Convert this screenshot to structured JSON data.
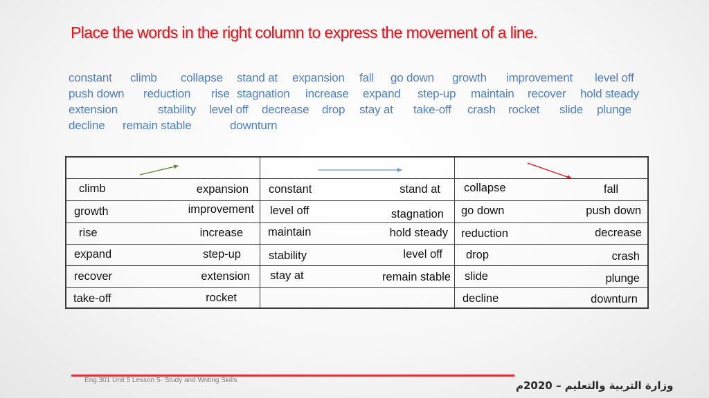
{
  "slide": {
    "title": "Place the words in the right column to express the movement of a line."
  },
  "word_bank": {
    "rows": [
      [
        "constant",
        "climb",
        "collapse",
        "stand at",
        "expansion",
        "fall",
        "go down",
        "growth",
        "improvement",
        "level off"
      ],
      [
        "push down",
        "reduction",
        "rise",
        "stagnation",
        "increase",
        "expand",
        "step-up",
        "maintain",
        "recover",
        "hold steady"
      ],
      [
        "extension",
        "stability",
        "level off",
        "decrease",
        "drop",
        "stay at",
        "take-off",
        "crash",
        "rocket",
        "slide",
        "plunge"
      ],
      [
        "decline",
        "remain stable",
        "downturn"
      ]
    ],
    "color": "#4f7fc6"
  },
  "table": {
    "columns": [
      {
        "direction": "upward",
        "arrow_color": "#5a8a2e",
        "rows": [
          [
            "climb",
            "expansion"
          ],
          [
            "growth",
            "improvement"
          ],
          [
            "rise",
            "increase"
          ],
          [
            "expand",
            "step-up"
          ],
          [
            "recover",
            "extension"
          ],
          [
            "take-off",
            "rocket"
          ]
        ]
      },
      {
        "direction": "steady",
        "arrow_color": "#6a9ad4",
        "rows": [
          [
            "constant",
            "stand at"
          ],
          [
            "level off",
            "stagnation"
          ],
          [
            "maintain",
            "hold steady"
          ],
          [
            "stability",
            "level off"
          ],
          [
            "stay at",
            "remain stable"
          ],
          [
            "",
            ""
          ]
        ]
      },
      {
        "direction": "downward",
        "arrow_color": "#e8141c",
        "rows": [
          [
            "collapse",
            "fall"
          ],
          [
            "go down",
            "push down"
          ],
          [
            "reduction",
            "decrease"
          ],
          [
            "drop",
            "crash"
          ],
          [
            "slide",
            "plunge"
          ],
          [
            "decline",
            "downturn"
          ]
        ]
      }
    ]
  },
  "footer": {
    "course": "Eng.301 Unit 5 Lesson 5- Study and Writing Skills",
    "ministry": "وزارة التربية والتعليم – 2020م",
    "accent_color": "#e0303a"
  }
}
